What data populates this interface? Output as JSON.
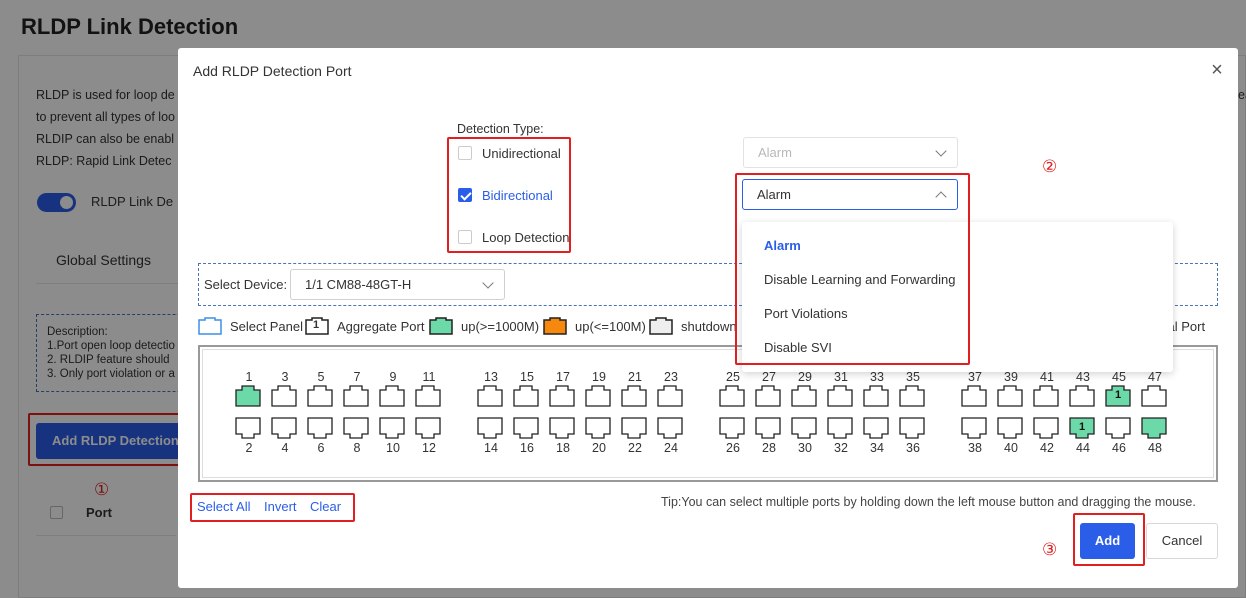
{
  "page": {
    "title": "RLDP Link Detection",
    "description_lines": [
      "RLDP is used for loop de",
      "to prevent all types of loo",
      "RLDIP can also be enabl",
      "RLDP: Rapid Link Detec"
    ],
    "trailing_fragment": "ea",
    "toggle_label": "RLDP Link De",
    "toggle_on": true,
    "tab_global": "Global Settings",
    "desc_box": [
      "Description:",
      "1.Port open loop detectio",
      "2. RLDIP feature should",
      "3. Only port violation or a"
    ],
    "add_button": "Add RLDP Detection P",
    "table_header_port": "Port"
  },
  "modal": {
    "title": "Add RLDP Detection Port",
    "close_icon": "close-icon",
    "detection_type_label": "Detection Type:",
    "options": {
      "unidirectional": {
        "label": "Unidirectional",
        "checked": false
      },
      "bidirectional": {
        "label": "Bidirectional",
        "checked": true
      },
      "loop_detection": {
        "label": "Loop Detection",
        "checked": false
      }
    },
    "unidirectional_action": "Alarm",
    "bidirectional_action": "Alarm",
    "action_dropdown": {
      "items": [
        "Alarm",
        "Disable Learning and Forwarding",
        "Port Violations",
        "Disable SVI"
      ],
      "selected": "Alarm"
    },
    "select_device_label": "Select Device:",
    "device_value": "1/1 CM88-48GT-H",
    "legend": {
      "select_panel": "Select Panel",
      "aggregate_port": "Aggregate Port",
      "aggregate_num": "1",
      "up_1000": "up(>=1000M)",
      "up_100": "up(<=100M)",
      "shutdown": "shutdown",
      "optical_port": "cal Port"
    },
    "ports_top": [
      "1",
      "3",
      "5",
      "7",
      "9",
      "11",
      "13",
      "15",
      "17",
      "19",
      "21",
      "23",
      "25",
      "27",
      "29",
      "31",
      "33",
      "35",
      "37",
      "39",
      "41",
      "43",
      "45",
      "47"
    ],
    "ports_bottom": [
      "2",
      "4",
      "6",
      "8",
      "10",
      "12",
      "14",
      "16",
      "18",
      "20",
      "22",
      "24",
      "26",
      "28",
      "30",
      "32",
      "34",
      "36",
      "38",
      "40",
      "42",
      "44",
      "46",
      "48"
    ],
    "port_status": {
      "1": "up",
      "45": "up-aggregate",
      "44": "up-aggregate",
      "48": "up"
    },
    "aggregate_label": "1",
    "links": {
      "select_all": "Select All",
      "invert": "Invert",
      "clear": "Clear"
    },
    "tip": "Tip:You can select multiple ports by holding down the left mouse button and dragging the mouse.",
    "add": "Add",
    "cancel": "Cancel"
  },
  "annotations": {
    "one": "①",
    "two": "②",
    "three": "③"
  },
  "colors": {
    "accent": "#2b5ee8",
    "annotation_red": "#e02020",
    "port_up_1000": "#6bd9a8",
    "port_up_100": "#f5890f",
    "port_shutdown": "#eeeeee"
  }
}
